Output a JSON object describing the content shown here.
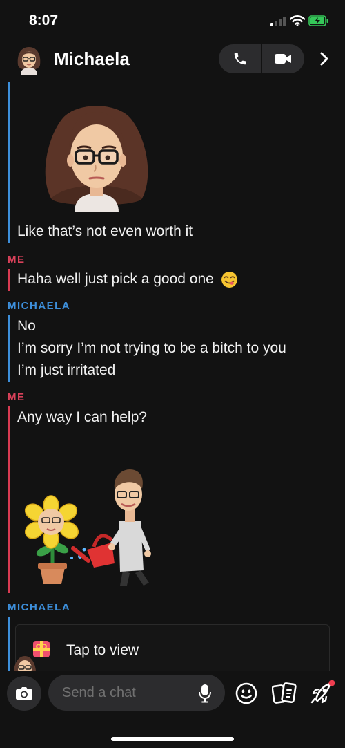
{
  "status_bar": {
    "time": "8:07"
  },
  "header": {
    "contact_name": "Michaela"
  },
  "messages": [
    {
      "text": "Like that’s not even worth it"
    },
    {
      "sender": "ME",
      "text": "Haha well just pick a good one"
    },
    {
      "sender": "MICHAELA",
      "lines": [
        "No",
        "I’m sorry I’m not trying to be a bitch to you",
        "I’m just irritated"
      ]
    },
    {
      "sender": "ME",
      "text": "Any way I can help?"
    },
    {
      "sender": "MICHAELA",
      "snap_label": "Tap to view"
    }
  ],
  "composer": {
    "placeholder": "Send a chat"
  },
  "colors": {
    "michaela": "#3d8fdb",
    "me": "#d93b52",
    "background": "#121212"
  },
  "icons": [
    "phone-icon",
    "video-icon",
    "chevron-right-icon",
    "camera-icon",
    "microphone-icon",
    "smiley-icon",
    "cards-icon",
    "rocket-icon",
    "gift-icon"
  ]
}
